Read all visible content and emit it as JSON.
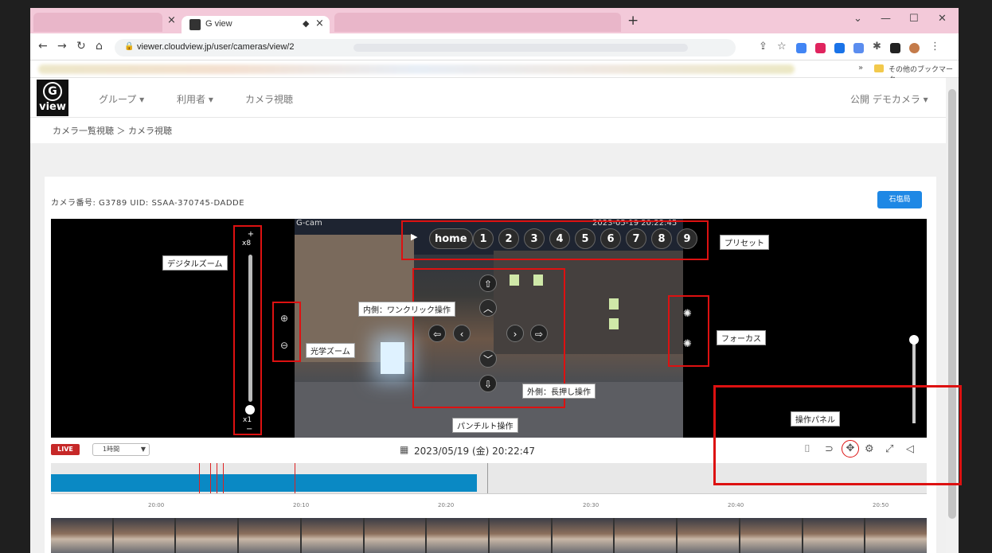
{
  "browser": {
    "tab_title": "G view",
    "url": "viewer.cloudview.jp/user/cameras/view/2",
    "other_bookmarks": "その他のブックマーク"
  },
  "app": {
    "logo_letter": "G",
    "logo_text": "view",
    "nav": [
      "グループ ▾",
      "利用者 ▾",
      "カメラ視聴"
    ],
    "user_menu": "公開 デモカメラ ▾",
    "breadcrumb": "カメラ一覧視聴 ＞ カメラ視聴",
    "camera_info": "カメラ番号: G3789 UID: SSAA-370745-DADDE",
    "edit_button": "石塩局"
  },
  "player": {
    "cam_label": "G-cam",
    "timestamp": "2023-05-19 20:22:45",
    "zoom_plus": "+",
    "zoom_max": "x8",
    "zoom_min": "x1",
    "zoom_minus": "−",
    "home": "home",
    "presets": [
      "1",
      "2",
      "3",
      "4",
      "5",
      "6",
      "7",
      "8",
      "9"
    ]
  },
  "annotations": {
    "digital_zoom": "デジタルズーム",
    "optical_zoom": "光学ズーム",
    "inner": "内側：ワンクリック操作",
    "outer": "外側：長押し操作",
    "pantilt": "パンチルト操作",
    "preset": "プリセット",
    "focus": "フォーカス",
    "control_panel": "操作パネル"
  },
  "controls": {
    "live": "LIVE",
    "range": "1時間",
    "datetime": "2023/05/19 (金) 20:22:47",
    "tools": [
      "camera-icon",
      "mic-icon",
      "ptz-move-icon",
      "settings-icon",
      "fullscreen-icon",
      "volume-icon"
    ]
  },
  "timeline": {
    "labels": [
      "20:00",
      "20:10",
      "20:20",
      "20:30",
      "20:40",
      "20:50"
    ]
  }
}
